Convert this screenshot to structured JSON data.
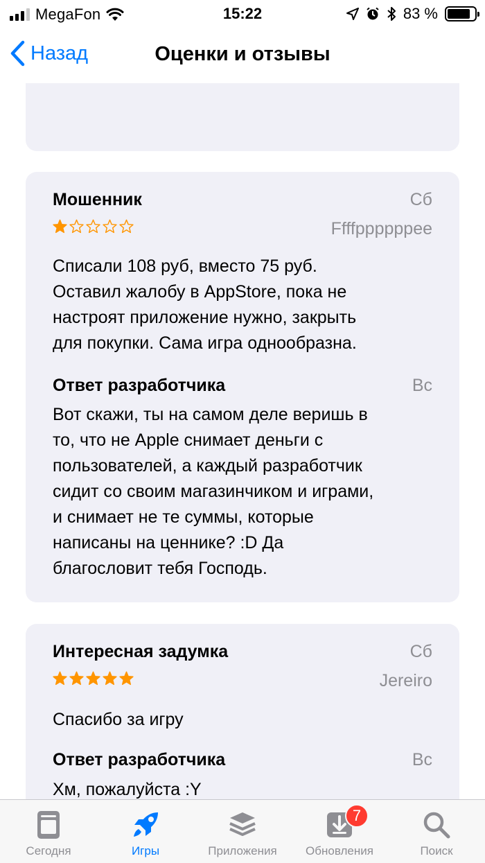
{
  "status_bar": {
    "carrier": "MegaFon",
    "time": "15:22",
    "battery_percent": "83 %",
    "battery_level": 0.83
  },
  "nav": {
    "back_label": "Назад",
    "title": "Оценки и отзывы"
  },
  "reviews": [
    {
      "title": "Мошенник",
      "date": "Сб",
      "author": "Ffffppppppee",
      "rating": 1,
      "body": "Списали 108 руб, вместо 75 руб.\nОставил жалобу в AppStore, пока не\nнастроят приложение нужно, закрыть\nдля покупки. Сама игра однообразна.",
      "developer_response": {
        "title": "Ответ разработчика",
        "date": "Вс",
        "body": "Вот скажи, ты на самом деле веришь в\nто, что не Apple снимает деньги с\nпользователей, а каждый разработчик\nсидит со своим магазинчиком и играми,\nи снимает не те суммы, которые\nнаписаны на ценнике? :D Да\nблагословит тебя Господь."
      }
    },
    {
      "title": "Интересная задумка",
      "date": "Сб",
      "author": "Jereiro",
      "rating": 5,
      "body": "Спасибо за игру",
      "developer_response": {
        "title": "Ответ разработчика",
        "date": "Вс",
        "body": "Хм, пожалуйста :Y"
      }
    }
  ],
  "tabs": [
    {
      "label": "Сегодня",
      "icon": "today-icon",
      "active": false
    },
    {
      "label": "Игры",
      "icon": "rocket-icon",
      "active": true
    },
    {
      "label": "Приложения",
      "icon": "apps-stack-icon",
      "active": false
    },
    {
      "label": "Обновления",
      "icon": "updates-download-icon",
      "active": false,
      "badge": "7"
    },
    {
      "label": "Поиск",
      "icon": "search-icon",
      "active": false
    }
  ],
  "colors": {
    "accent": "#007aff",
    "star": "#ff9500",
    "secondary_text": "#8e8e93",
    "card_bg": "#f0f0f7",
    "badge": "#ff3b30"
  }
}
